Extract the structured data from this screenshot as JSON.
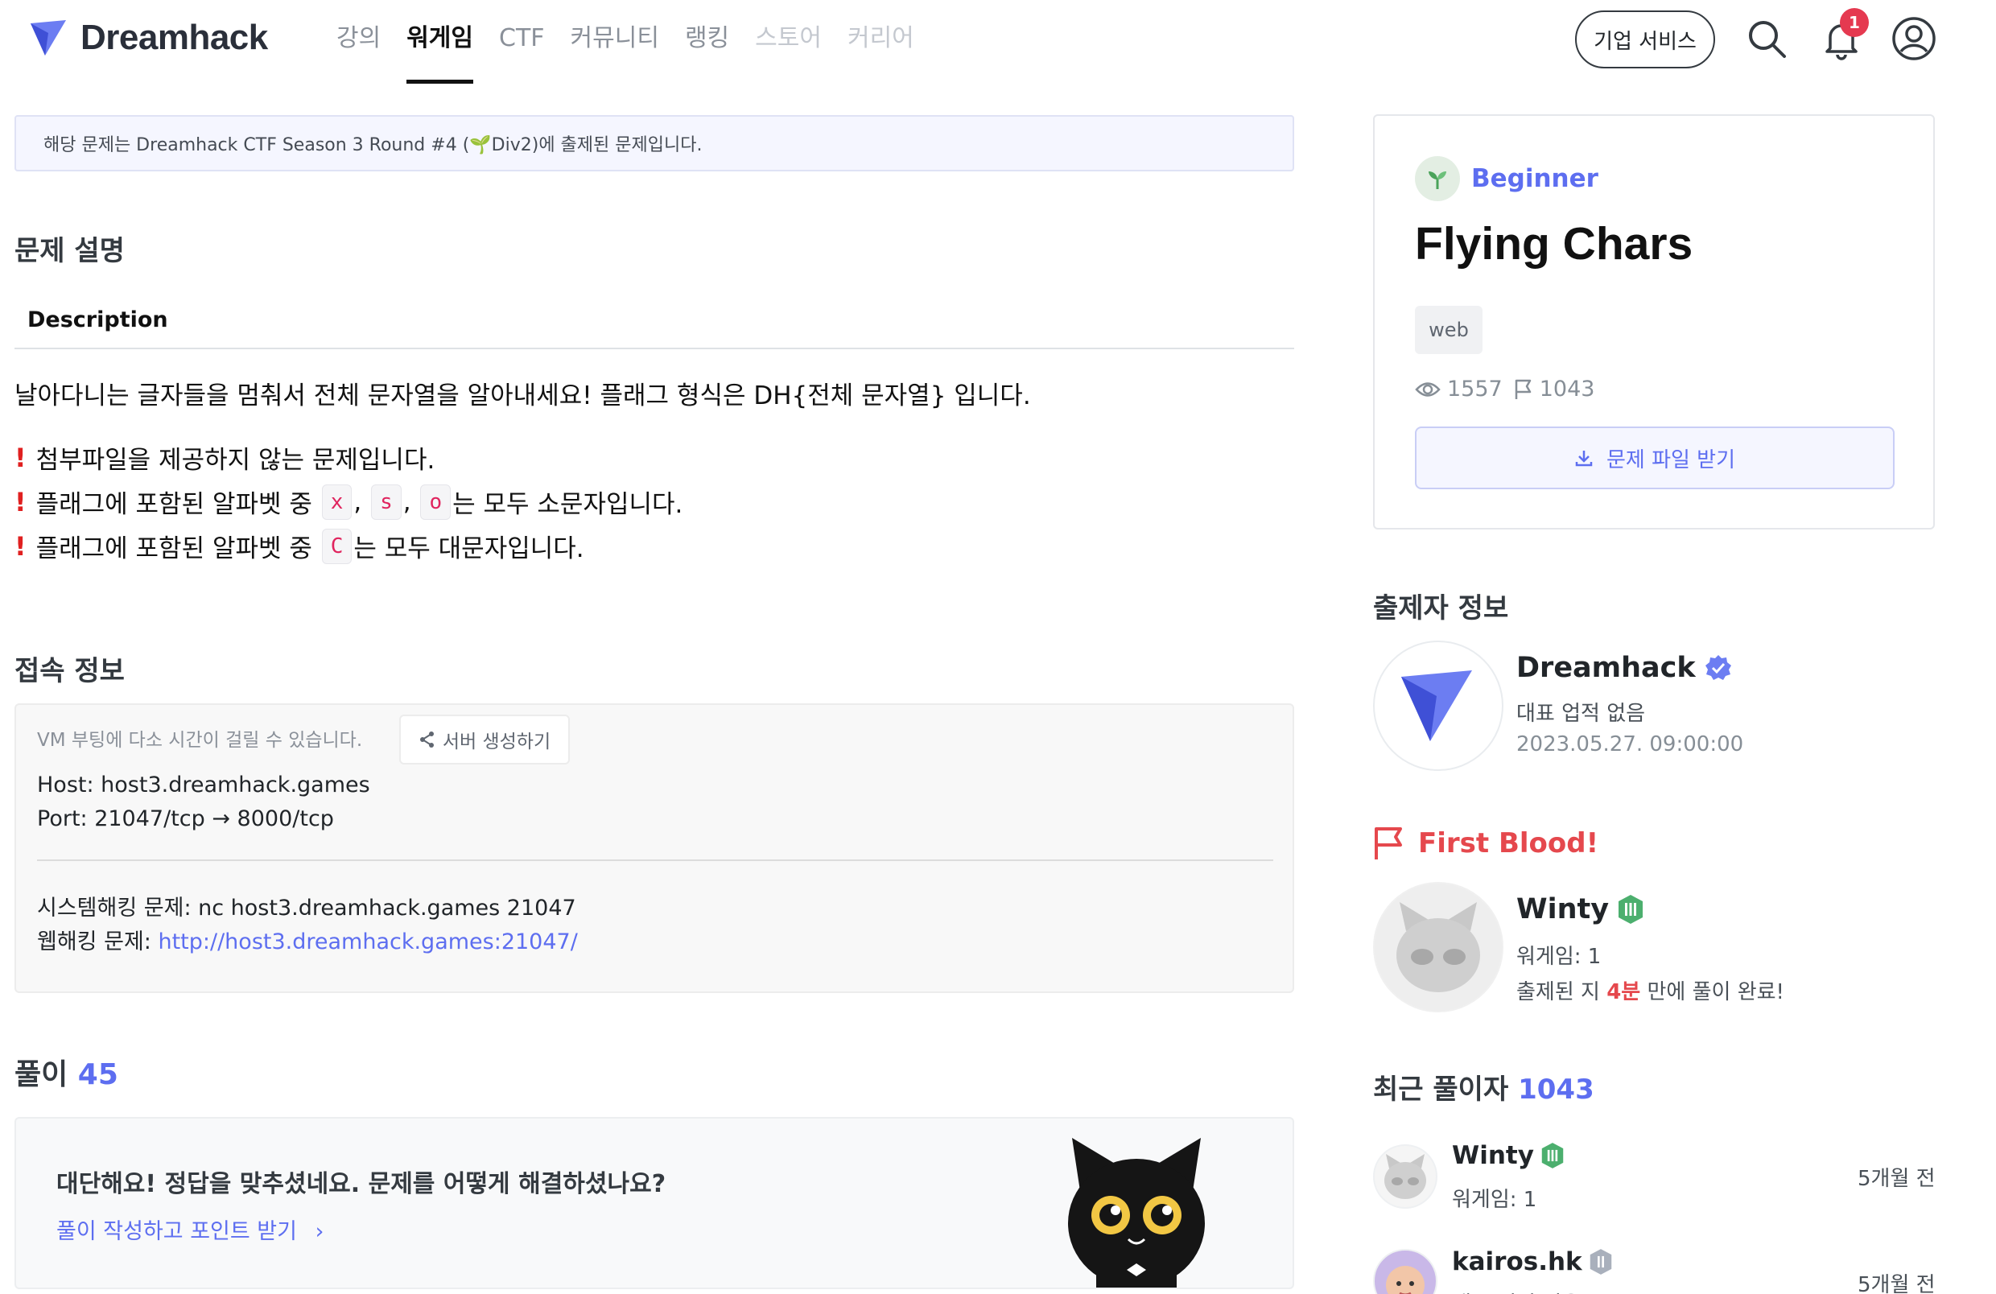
{
  "brand": {
    "name": "Dreamhack",
    "accent": "#5d6ef0"
  },
  "nav": [
    {
      "label": "강의",
      "state": "normal"
    },
    {
      "label": "워게임",
      "state": "active"
    },
    {
      "label": "CTF",
      "state": "normal"
    },
    {
      "label": "커뮤니티",
      "state": "normal"
    },
    {
      "label": "랭킹",
      "state": "normal"
    },
    {
      "label": "스토어",
      "state": "muted"
    },
    {
      "label": "커리어",
      "state": "muted"
    }
  ],
  "header": {
    "business_button": "기업 서비스",
    "notification_count": "1",
    "icons": [
      "search-icon",
      "bell-icon",
      "user-icon"
    ]
  },
  "notice": "해당 문제는 Dreamhack CTF Season 3 Round #4 (🌱Div2)에 출제된 문제입니다.",
  "description": {
    "section_title": "문제 설명",
    "heading": "Description",
    "intro": "날아다니는 글자들을 멈춰서 전체 문자열을 알아내세요! 플래그 형식은 DH{전체 문자열} 입니다.",
    "note1": "첨부파일을 제공하지 않는 문제입니다.",
    "note2_prefix": "플래그에 포함된 알파벳 중",
    "note2_codes": [
      "x",
      "s",
      "o"
    ],
    "note2_sep": ",",
    "note2_suffix": "는 모두 소문자입니다.",
    "note3_prefix": "플래그에 포함된 알파벳 중",
    "note3_code": "C",
    "note3_suffix": "는 모두 대문자입니다."
  },
  "connection": {
    "section_title": "접속 정보",
    "hint": "VM 부팅에 다소 시간이 걸릴 수 있습니다.",
    "server_button": "서버 생성하기",
    "host": "Host: host3.dreamhack.games",
    "port": "Port:  21047/tcp → 8000/tcp",
    "system_label": "시스템해킹 문제: nc host3.dreamhack.games 21047",
    "web_label": "웹해킹 문제: ",
    "web_url": "http://host3.dreamhack.games:21047/"
  },
  "solutions": {
    "label": "풀이",
    "count": "45",
    "question": "대단해요! 정답을 맞추셨네요. 문제를 어떻게 해결하셨나요?",
    "cta": "풀이 작성하고 포인트 받기"
  },
  "challenge": {
    "level": "Beginner",
    "title": "Flying Chars",
    "tag": "web",
    "views": "1557",
    "solves": "1043",
    "download": "문제 파일 받기"
  },
  "author": {
    "section_title": "출제자 정보",
    "name": "Dreamhack",
    "subtitle": "대표 업적 없음",
    "date": "2023.05.27. 09:00:00"
  },
  "first_blood": {
    "label": "First Blood!",
    "name": "Winty",
    "wargame": "워게임: 1",
    "time_prefix": "출제된 지 ",
    "time_value": "4분",
    "time_suffix": " 만에 풀이 완료!"
  },
  "recent": {
    "label": "최근 풀이자",
    "count": "1043",
    "items": [
      {
        "name": "Winty",
        "sub": "워게임: 1",
        "time": "5개월 전"
      },
      {
        "name": "kairos.hk",
        "sub": "대표 업적 없음",
        "time": "5개월 전"
      }
    ]
  }
}
